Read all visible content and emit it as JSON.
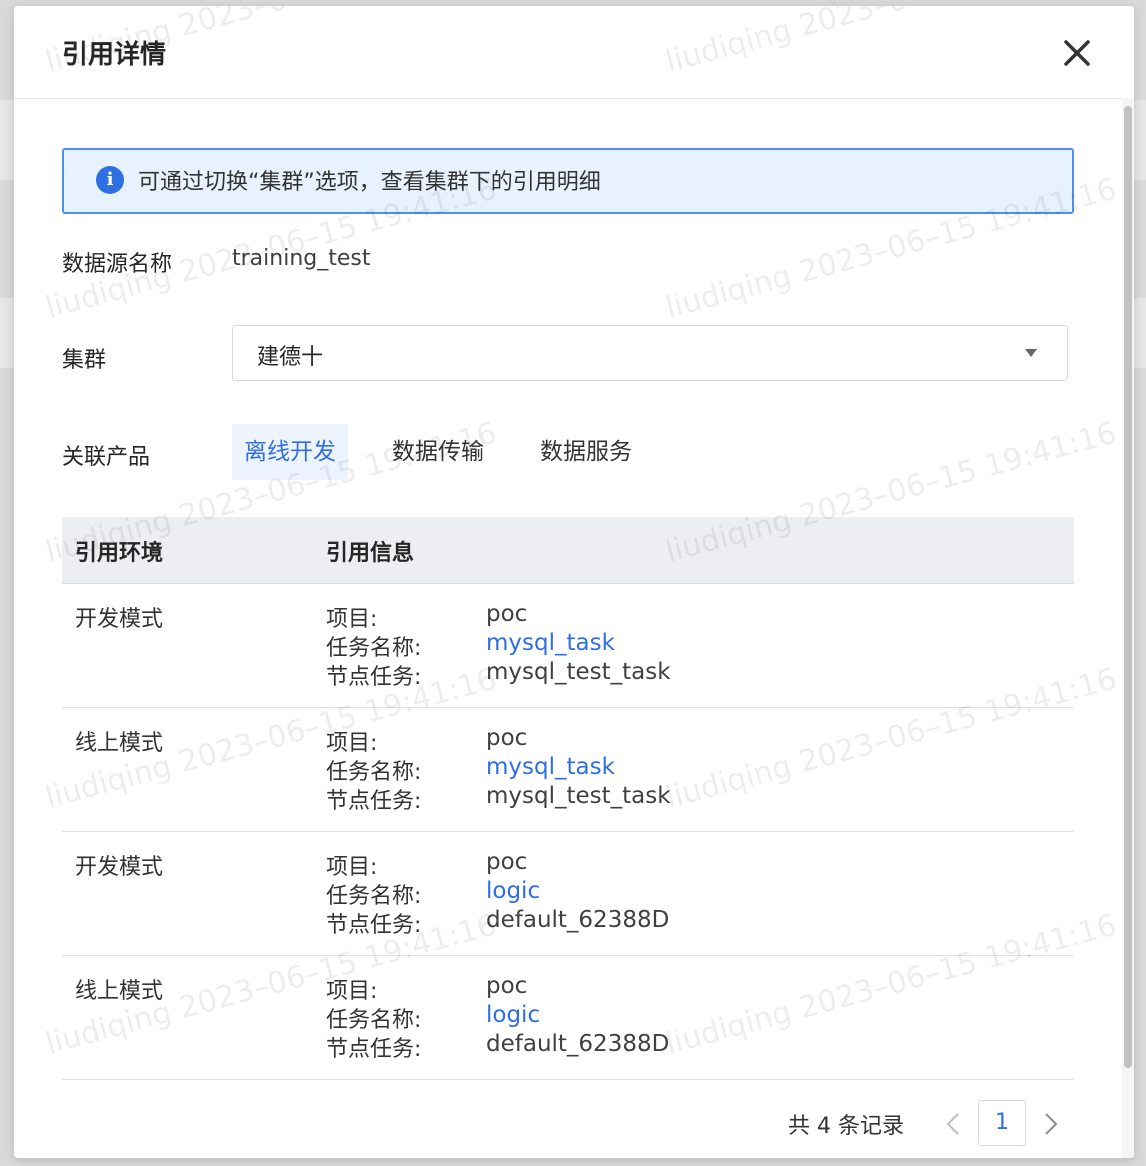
{
  "modal": {
    "title": "引用详情"
  },
  "alert": {
    "text": "可通过切换“集群”选项，查看集群下的引用明细",
    "icon": "info-icon"
  },
  "form": {
    "datasource_label": "数据源名称",
    "datasource_value": "training_test",
    "cluster_label": "集群",
    "cluster_value": "建德十",
    "product_label": "关联产品"
  },
  "tabs": [
    {
      "label": "离线开发",
      "active": true
    },
    {
      "label": "数据传输",
      "active": false
    },
    {
      "label": "数据服务",
      "active": false
    }
  ],
  "table": {
    "columns": [
      "引用环境",
      "引用信息"
    ],
    "key_labels": {
      "project": "项目:",
      "task": "任务名称:",
      "node": "节点任务:"
    },
    "rows": [
      {
        "env": "开发模式",
        "project": "poc",
        "task": "mysql_task",
        "node": "mysql_test_task"
      },
      {
        "env": "线上模式",
        "project": "poc",
        "task": "mysql_task",
        "node": "mysql_test_task"
      },
      {
        "env": "开发模式",
        "project": "poc",
        "task": "logic",
        "node": "default_62388D"
      },
      {
        "env": "线上模式",
        "project": "poc",
        "task": "logic",
        "node": "default_62388D"
      }
    ]
  },
  "pagination": {
    "total_text": "共 4 条记录",
    "current_page": "1"
  },
  "watermark": {
    "text": "liudiqing 2023–06–15 19:41:16"
  },
  "colors": {
    "accent": "#2f6fe4",
    "alert_bg": "#e8f2ff",
    "alert_border": "#4d8ff4",
    "table_head_bg": "#eceef2"
  }
}
